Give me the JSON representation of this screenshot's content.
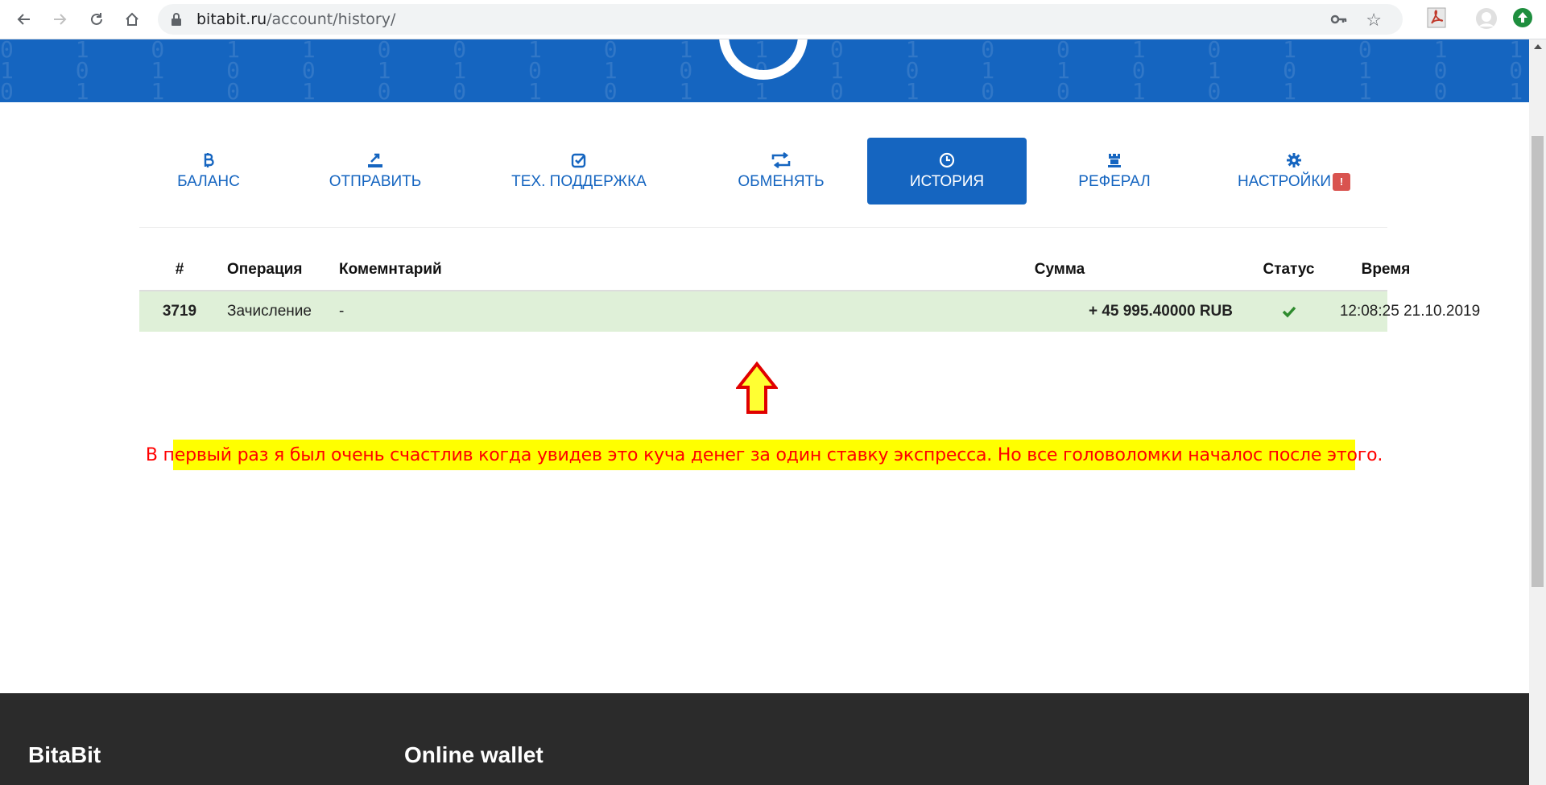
{
  "browser": {
    "url_host": "bitabit.ru",
    "url_path": "/account/history/"
  },
  "tabs": [
    {
      "label": "БАЛАНС",
      "icon": "bitcoin-icon",
      "active": false
    },
    {
      "label": "ОТПРАВИТЬ",
      "icon": "send-icon",
      "active": false
    },
    {
      "label": "ТЕХ. ПОДДЕРЖКА",
      "icon": "check-square-icon",
      "active": false
    },
    {
      "label": "ОБМЕНЯТЬ",
      "icon": "exchange-icon",
      "active": false
    },
    {
      "label": "ИСТОРИЯ",
      "icon": "clock-icon",
      "active": true
    },
    {
      "label": "РЕФЕРАЛ",
      "icon": "rook-icon",
      "active": false
    },
    {
      "label": "НАСТРОЙКИ",
      "icon": "gear-icon",
      "active": false,
      "badge": "!"
    }
  ],
  "table": {
    "headers": {
      "num": "#",
      "operation": "Операция",
      "comment": "Комемнтарий",
      "sum": "Сумма",
      "status": "Статус",
      "time": "Время"
    },
    "rows": [
      {
        "num": "3719",
        "operation": "Зачисление",
        "comment": "-",
        "sum": "+ 45 995.40000 RUB",
        "status": "check-icon",
        "time": "12:08:25 21.10.2019"
      }
    ]
  },
  "annotation": {
    "text": "В первый раз я был очень счастлив когда увидев это куча денег за один ставку экспресса. Но все головоломки началос после этого."
  },
  "footer": {
    "brand": "BitaBit",
    "col2_title": "Online wallet"
  },
  "colors": {
    "primary": "#1565c0",
    "row_success": "#dff0d8",
    "note_bg": "#ffff00",
    "note_text": "#ff0000",
    "footer_bg": "#2b2b2b",
    "badge": "#d9534f"
  }
}
